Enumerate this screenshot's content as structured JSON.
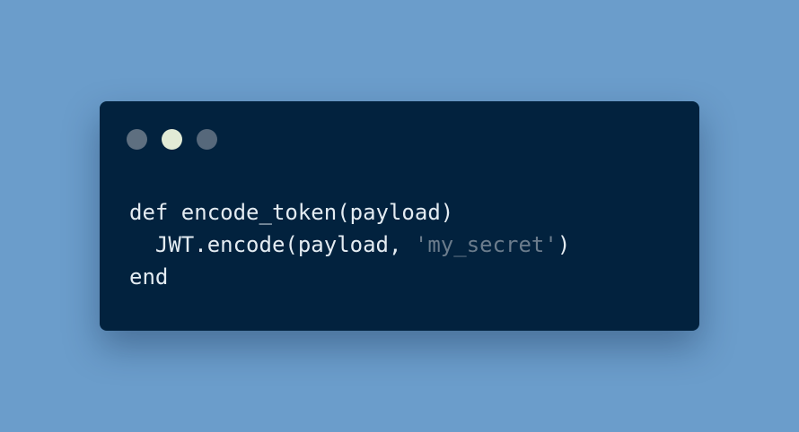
{
  "colors": {
    "background": "#6b9dcb",
    "window": "#02223e",
    "text": "#e4ecf2",
    "string": "#6b7c8c",
    "dot_left": "#5e6f80",
    "dot_middle": "#e2ebd6",
    "dot_right": "#56687b"
  },
  "window_dots": [
    {
      "name": "dot-1",
      "color": "#5e6f80"
    },
    {
      "name": "dot-2",
      "color": "#e2ebd6"
    },
    {
      "name": "dot-3",
      "color": "#56687b"
    }
  ],
  "code": {
    "line1": "def encode_token(payload)",
    "line2_prefix": "  JWT.encode(payload, ",
    "line2_string": "'my_secret'",
    "line2_suffix": ")",
    "line3": "end"
  }
}
